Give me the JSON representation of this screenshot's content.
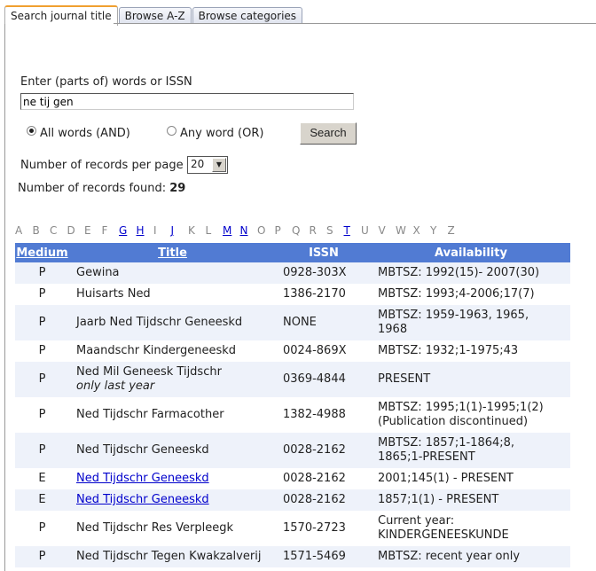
{
  "tabs": [
    {
      "label": "Search journal title",
      "active": true
    },
    {
      "label": "Browse A-Z"
    },
    {
      "label": "Browse categories"
    }
  ],
  "search": {
    "label": "Enter (parts of) words or ISSN",
    "value": "ne tij gen",
    "option_and": "All words (AND)",
    "option_or": "Any word (OR)",
    "selected": "and",
    "button": "Search"
  },
  "per_page": {
    "label": "Number of records per page",
    "value": "20"
  },
  "found": {
    "label": "Number of records found:",
    "count": "29"
  },
  "letters": [
    {
      "l": "A"
    },
    {
      "l": "B"
    },
    {
      "l": "C"
    },
    {
      "l": "D"
    },
    {
      "l": "E"
    },
    {
      "l": "F"
    },
    {
      "l": "G",
      "link": true
    },
    {
      "l": "H",
      "link": true
    },
    {
      "l": "I"
    },
    {
      "l": "J",
      "link": true
    },
    {
      "l": "K"
    },
    {
      "l": "L"
    },
    {
      "l": "M",
      "link": true
    },
    {
      "l": "N",
      "link": true
    },
    {
      "l": "O"
    },
    {
      "l": "P"
    },
    {
      "l": "Q"
    },
    {
      "l": "R"
    },
    {
      "l": "S"
    },
    {
      "l": "T",
      "link": true
    },
    {
      "l": "U"
    },
    {
      "l": "V"
    },
    {
      "l": "W"
    },
    {
      "l": "X"
    },
    {
      "l": "Y"
    },
    {
      "l": "Z"
    }
  ],
  "table": {
    "headers": {
      "medium": "Medium",
      "title": "Title",
      "issn": "ISSN",
      "availability": "Availability"
    },
    "colors": {
      "header": "#517bd3",
      "odd": "#eef2fa"
    },
    "rows": [
      {
        "medium": "P",
        "title": "Gewina",
        "issn": "0928-303X",
        "availability": [
          "MBTSZ: 1992(15)- 2007(30)"
        ]
      },
      {
        "medium": "P",
        "title": "Huisarts Ned",
        "issn": "1386-2170",
        "availability": [
          "MBTSZ: 1993;4-2006;17(7)"
        ]
      },
      {
        "medium": "P",
        "title": "Jaarb Ned Tijdschr Geneeskd",
        "issn": "NONE",
        "availability": [
          "MBTSZ: 1959-1963, 1965,",
          "1968"
        ]
      },
      {
        "medium": "P",
        "title": "Maandschr Kindergeneeskd",
        "issn": "0024-869X",
        "availability": [
          "MBTSZ: 1932;1-1975;43"
        ]
      },
      {
        "medium": "P",
        "title": "Ned Mil Geneesk Tijdschr",
        "note": "only last year",
        "issn": "0369-4844",
        "availability": [
          "PRESENT"
        ]
      },
      {
        "medium": "P",
        "title": "Ned Tijdschr Farmacother",
        "issn": "1382-4988",
        "availability": [
          "MBTSZ: 1995;1(1)-1995;1(2)",
          "(Publication discontinued)"
        ]
      },
      {
        "medium": "P",
        "title": "Ned Tijdschr Geneeskd",
        "issn": "0028-2162",
        "availability": [
          "MBTSZ: 1857;1-1864;8,",
          "1865;1-PRESENT"
        ]
      },
      {
        "medium": "E",
        "title": "Ned Tijdschr Geneeskd",
        "link": true,
        "issn": "0028-2162",
        "availability": [
          "2001;145(1) - PRESENT"
        ]
      },
      {
        "medium": "E",
        "title": "Ned Tijdschr Geneeskd",
        "link": true,
        "issn": "0028-2162",
        "availability": [
          "1857;1(1) - PRESENT"
        ]
      },
      {
        "medium": "P",
        "title": "Ned Tijdschr Res Verpleegk",
        "issn": "1570-2723",
        "availability": [
          "Current year:",
          "KINDERGENEESKUNDE"
        ]
      },
      {
        "medium": "P",
        "title": "Ned Tijdschr Tegen Kwakzalverij",
        "issn": "1571-5469",
        "availability": [
          "MBTSZ: recent year only"
        ]
      }
    ]
  }
}
